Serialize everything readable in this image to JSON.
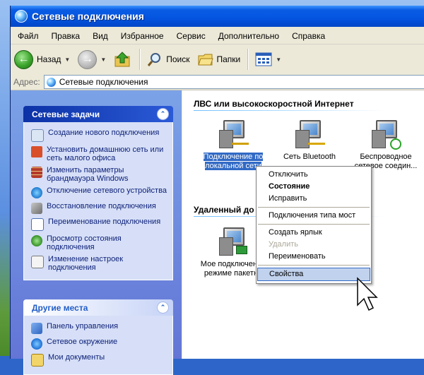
{
  "window": {
    "title": "Сетевые подключения"
  },
  "menubar": [
    "Файл",
    "Правка",
    "Вид",
    "Избранное",
    "Сервис",
    "Дополнительно",
    "Справка"
  ],
  "toolbar": {
    "back": "Назад",
    "search": "Поиск",
    "folders": "Папки"
  },
  "address": {
    "label": "Адрес:",
    "value": "Сетевые подключения"
  },
  "sidebar": {
    "network_tasks": {
      "title": "Сетевые задачи",
      "items": [
        "Создание нового подключения",
        "Установить домашнюю сеть или сеть малого офиса",
        "Изменить параметры брандмауэра Windows",
        "Отключение сетевого устройства",
        "Восстановление подключения",
        "Переименование подключения",
        "Просмотр состояния подключения",
        "Изменение настроек подключения"
      ]
    },
    "other_places": {
      "title": "Другие места",
      "items": [
        "Панель управления",
        "Сетевое окружение",
        "Мои документы"
      ]
    }
  },
  "content": {
    "lan_group": {
      "title": "ЛВС или высокоскоростной Интернет",
      "connections": [
        {
          "label": "Подключение по локальной сети",
          "selected": true
        },
        {
          "label": "Сеть Bluetooth",
          "selected": false
        },
        {
          "label": "Беспроводное сетевое соедин...",
          "selected": false
        }
      ]
    },
    "remote_group": {
      "title": "Удаленный до",
      "connections": [
        {
          "label": "Мое подключение режиме пакетно"
        }
      ]
    }
  },
  "context_menu": {
    "items": [
      {
        "label": "Отключить",
        "style": "normal"
      },
      {
        "label": "Состояние",
        "style": "bold"
      },
      {
        "label": "Исправить",
        "style": "normal"
      },
      {
        "separator": true
      },
      {
        "label": "Подключения типа мост",
        "style": "normal"
      },
      {
        "separator": true
      },
      {
        "label": "Создать ярлык",
        "style": "normal"
      },
      {
        "label": "Удалить",
        "style": "disabled"
      },
      {
        "label": "Переименовать",
        "style": "normal"
      },
      {
        "separator": true
      },
      {
        "label": "Свойства",
        "style": "highlight"
      }
    ]
  },
  "colors": {
    "title_bar": "#0454e0",
    "selection": "#316ac5",
    "sidebar": "#6f8ee0",
    "task_link": "#0c1f78"
  }
}
